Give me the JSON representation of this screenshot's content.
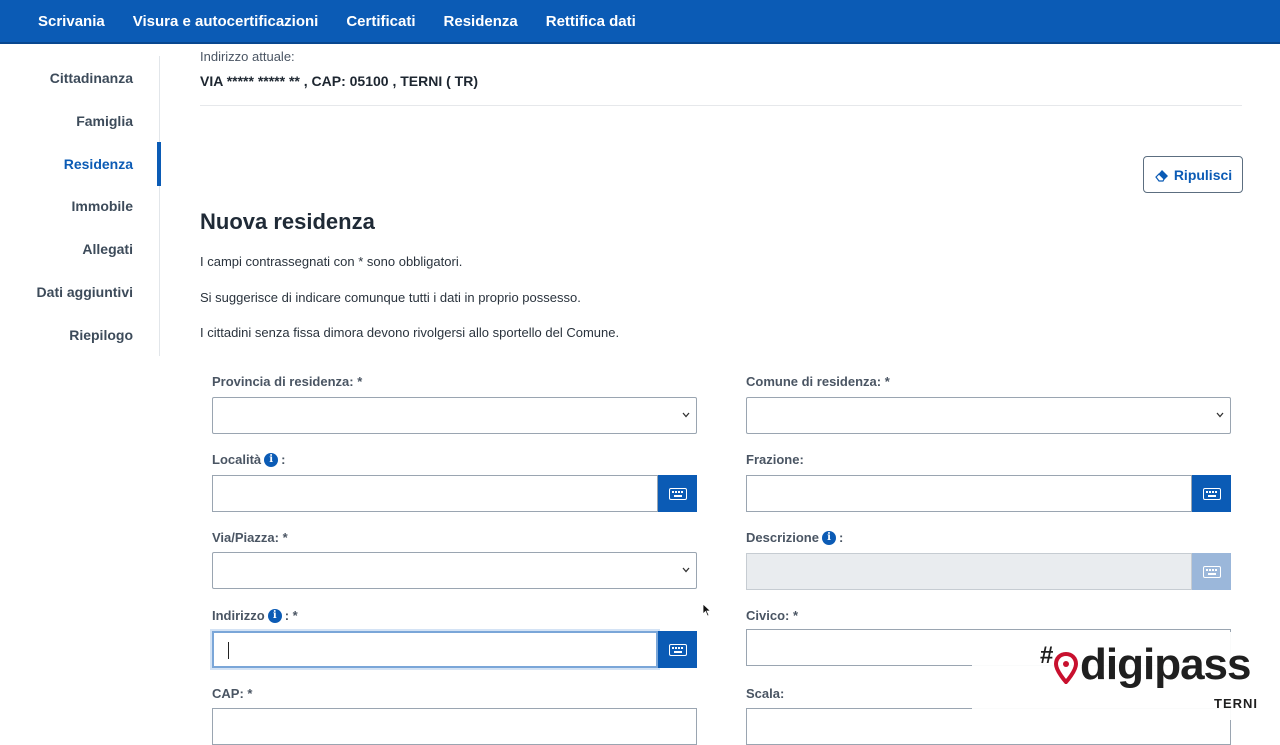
{
  "topnav": {
    "items": [
      "Scrivania",
      "Visura e autocertificazioni",
      "Certificati",
      "Residenza",
      "Rettifica dati"
    ]
  },
  "sidebar": {
    "items": [
      {
        "label": "Cittadinanza"
      },
      {
        "label": "Famiglia"
      },
      {
        "label": "Residenza",
        "active": true
      },
      {
        "label": "Immobile"
      },
      {
        "label": "Allegati"
      },
      {
        "label": "Dati aggiuntivi"
      },
      {
        "label": "Riepilogo"
      }
    ]
  },
  "current_address": {
    "label": "Indirizzo attuale:",
    "value": "VIA ***** ***** ** , CAP: 05100 , TERNI ( TR)"
  },
  "clear_button": {
    "label": "Ripulisci",
    "icon": "eraser-icon"
  },
  "section": {
    "title": "Nuova residenza",
    "notes": [
      "I campi contrassegnati con * sono obbligatori.",
      "Si suggerisce di indicare comunque tutti i dati in proprio possesso.",
      "I cittadini senza fissa dimora devono rivolgersi allo sportello del Comune."
    ]
  },
  "form": {
    "provincia_label": "Provincia di residenza: *",
    "comune_label": "Comune di residenza: *",
    "localita_label": "Località",
    "frazione_label": "Frazione:",
    "via_piazza_label": "Via/Piazza: *",
    "descrizione_label": "Descrizione",
    "indirizzo_label": "Indirizzo",
    "civico_label": "Civico: *",
    "cap_label": "CAP: *",
    "scala_label": "Scala:",
    "label_colon": ":",
    "label_required_colon": ": *",
    "info_glyph": "i"
  },
  "logo": {
    "hash": "#",
    "brand": "digipass",
    "city": "TERNI"
  },
  "colors": {
    "primary": "#0b5bb5",
    "logo_red": "#c8102e"
  }
}
